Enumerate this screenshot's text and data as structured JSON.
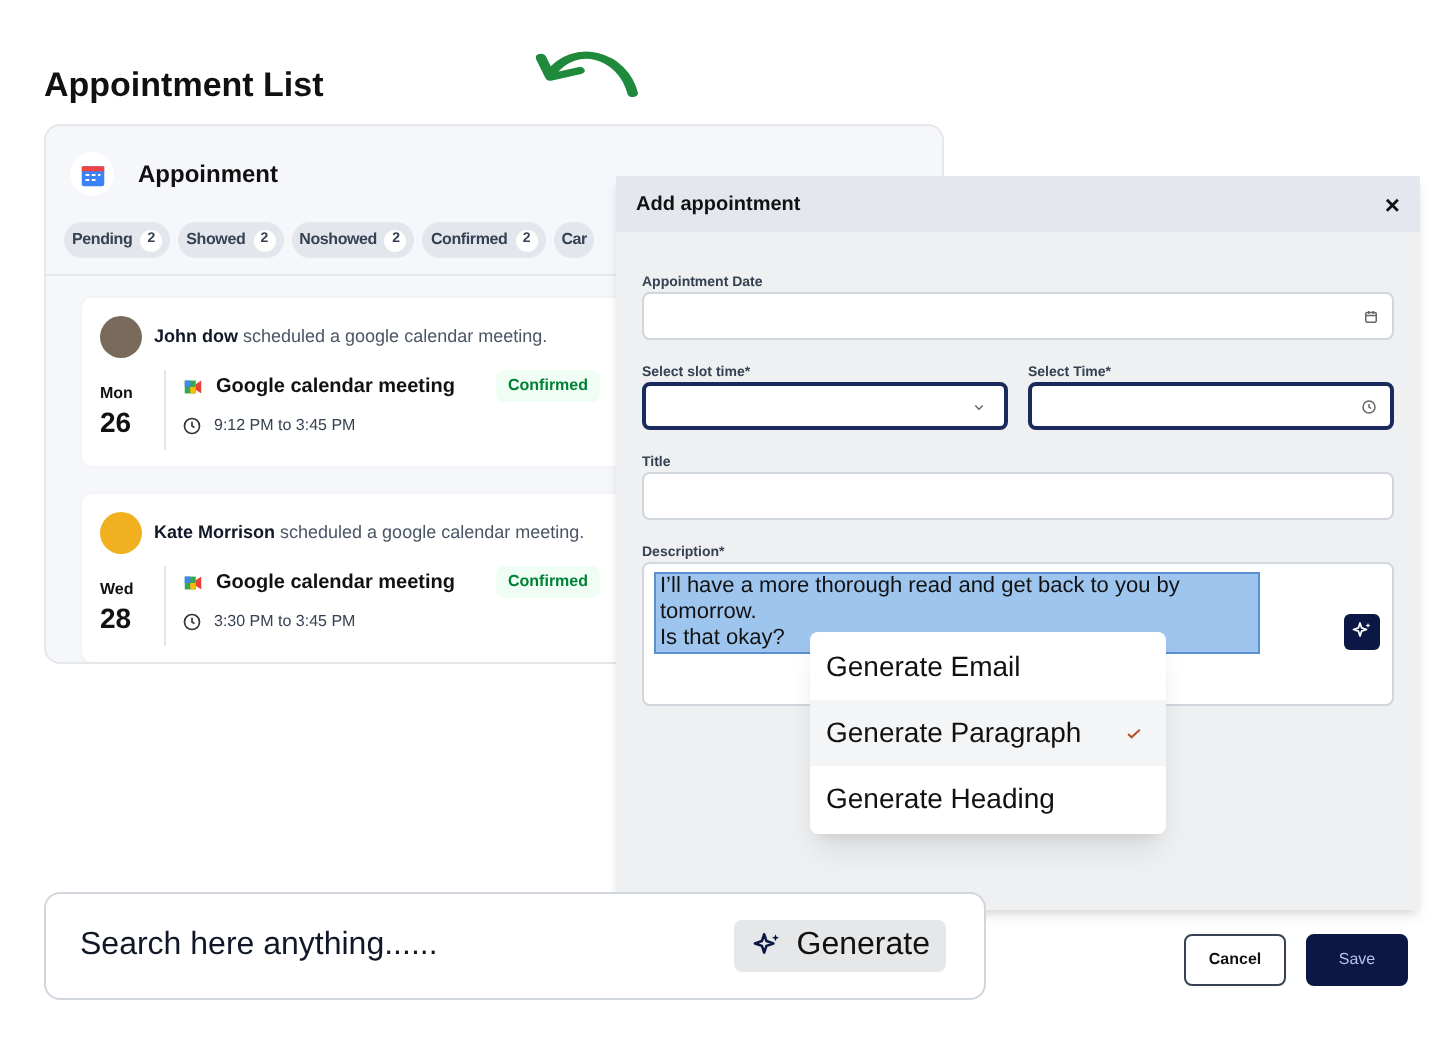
{
  "page_title": "Appointment List",
  "appointments": {
    "title": "Appoinment",
    "tabs": [
      {
        "label": "Pending",
        "count": "2"
      },
      {
        "label": "Showed",
        "count": "2"
      },
      {
        "label": "Noshowed",
        "count": "2"
      },
      {
        "label": "Confirmed",
        "count": "2"
      },
      {
        "label": "Car"
      }
    ],
    "items": [
      {
        "name": "John dow",
        "action": "scheduled a google calendar meeting.",
        "day": "Mon",
        "date": "26",
        "meeting": "Google calendar meeting",
        "time": "9:12 PM to 3:45 PM",
        "status": "Confirmed"
      },
      {
        "name": "Kate Morrison",
        "action": "scheduled a google calendar meeting.",
        "day": "Wed",
        "date": "28",
        "meeting": "Google calendar meeting",
        "time": "3:30 PM to 3:45 PM",
        "status": "Confirmed"
      }
    ]
  },
  "modal": {
    "title": "Add appointment",
    "close": "×",
    "fields": [
      {
        "label": "Appointment Date",
        "kind": "date"
      },
      {
        "label": "Select slot time*",
        "kind": "select"
      },
      {
        "label": "Select Time*",
        "kind": "time"
      },
      {
        "label": "Title",
        "kind": "text"
      },
      {
        "label": "Description*",
        "kind": "textarea",
        "value_lines": [
          "I’ll have a more thorough read and get back to you by tomorrow.",
          "Is that okay?"
        ]
      }
    ],
    "menu": [
      {
        "label": "Generate Email",
        "selected": false
      },
      {
        "label": "Generate Paragraph",
        "selected": true
      },
      {
        "label": "Generate Heading",
        "selected": false
      }
    ],
    "buttons": [
      {
        "label": "Cancel",
        "kind": "secondary"
      },
      {
        "label": "Save",
        "kind": "primary"
      }
    ]
  },
  "search": {
    "placeholder": "Search here anything......",
    "button": "Generate"
  }
}
